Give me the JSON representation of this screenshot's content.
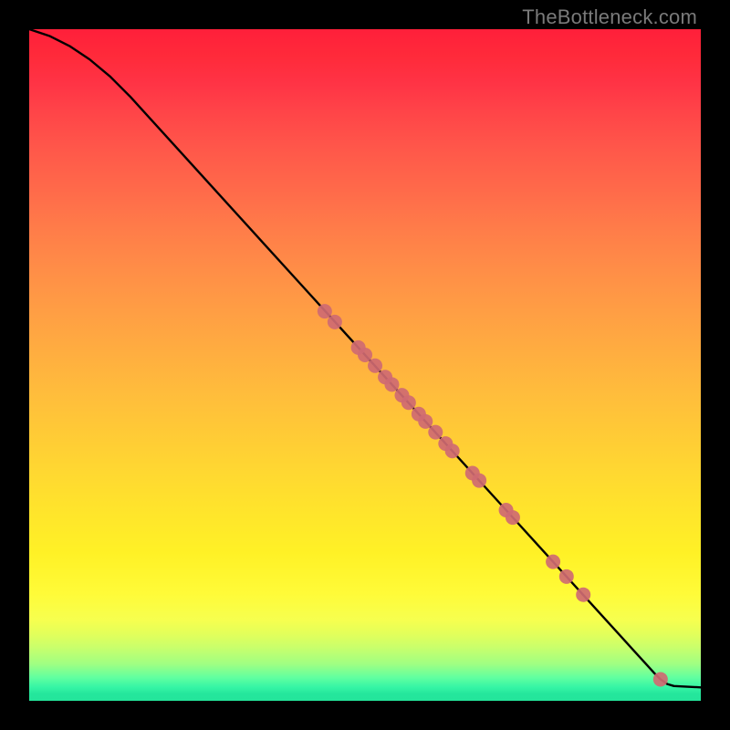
{
  "watermark": "TheBottleneck.com",
  "chart_data": {
    "type": "line",
    "title": "",
    "xlabel": "",
    "ylabel": "",
    "xlim": [
      0,
      100
    ],
    "ylim": [
      0,
      100
    ],
    "curve": [
      {
        "x": 0,
        "y": 100
      },
      {
        "x": 3,
        "y": 99
      },
      {
        "x": 6,
        "y": 97.5
      },
      {
        "x": 9,
        "y": 95.5
      },
      {
        "x": 12,
        "y": 93
      },
      {
        "x": 15,
        "y": 90
      },
      {
        "x": 20,
        "y": 84.5
      },
      {
        "x": 25,
        "y": 79
      },
      {
        "x": 30,
        "y": 73.5
      },
      {
        "x": 35,
        "y": 68
      },
      {
        "x": 40,
        "y": 62.5
      },
      {
        "x": 45,
        "y": 57
      },
      {
        "x": 50,
        "y": 51.5
      },
      {
        "x": 55,
        "y": 46
      },
      {
        "x": 60,
        "y": 40.5
      },
      {
        "x": 65,
        "y": 35
      },
      {
        "x": 70,
        "y": 29.5
      },
      {
        "x": 75,
        "y": 24
      },
      {
        "x": 80,
        "y": 18.5
      },
      {
        "x": 85,
        "y": 13
      },
      {
        "x": 88,
        "y": 9.7
      },
      {
        "x": 90,
        "y": 7.5
      },
      {
        "x": 92,
        "y": 5.3
      },
      {
        "x": 93,
        "y": 4.2
      },
      {
        "x": 94,
        "y": 3.2
      },
      {
        "x": 95,
        "y": 2.5
      },
      {
        "x": 96,
        "y": 2.2
      },
      {
        "x": 100,
        "y": 2.0
      }
    ],
    "points": [
      {
        "x": 44.0,
        "y": 58.0
      },
      {
        "x": 45.5,
        "y": 56.4
      },
      {
        "x": 49.0,
        "y": 52.6
      },
      {
        "x": 50.0,
        "y": 51.5
      },
      {
        "x": 51.5,
        "y": 49.9
      },
      {
        "x": 53.0,
        "y": 48.2
      },
      {
        "x": 54.0,
        "y": 47.1
      },
      {
        "x": 55.5,
        "y": 45.5
      },
      {
        "x": 56.5,
        "y": 44.4
      },
      {
        "x": 58.0,
        "y": 42.7
      },
      {
        "x": 59.0,
        "y": 41.6
      },
      {
        "x": 60.5,
        "y": 40.0
      },
      {
        "x": 62.0,
        "y": 38.3
      },
      {
        "x": 63.0,
        "y": 37.2
      },
      {
        "x": 66.0,
        "y": 33.9
      },
      {
        "x": 67.0,
        "y": 32.8
      },
      {
        "x": 71.0,
        "y": 28.4
      },
      {
        "x": 72.0,
        "y": 27.3
      },
      {
        "x": 78.0,
        "y": 20.7
      },
      {
        "x": 80.0,
        "y": 18.5
      },
      {
        "x": 82.5,
        "y": 15.8
      },
      {
        "x": 94.0,
        "y": 3.2
      }
    ],
    "point_color": "#cf6a72",
    "line_color": "#000000"
  }
}
